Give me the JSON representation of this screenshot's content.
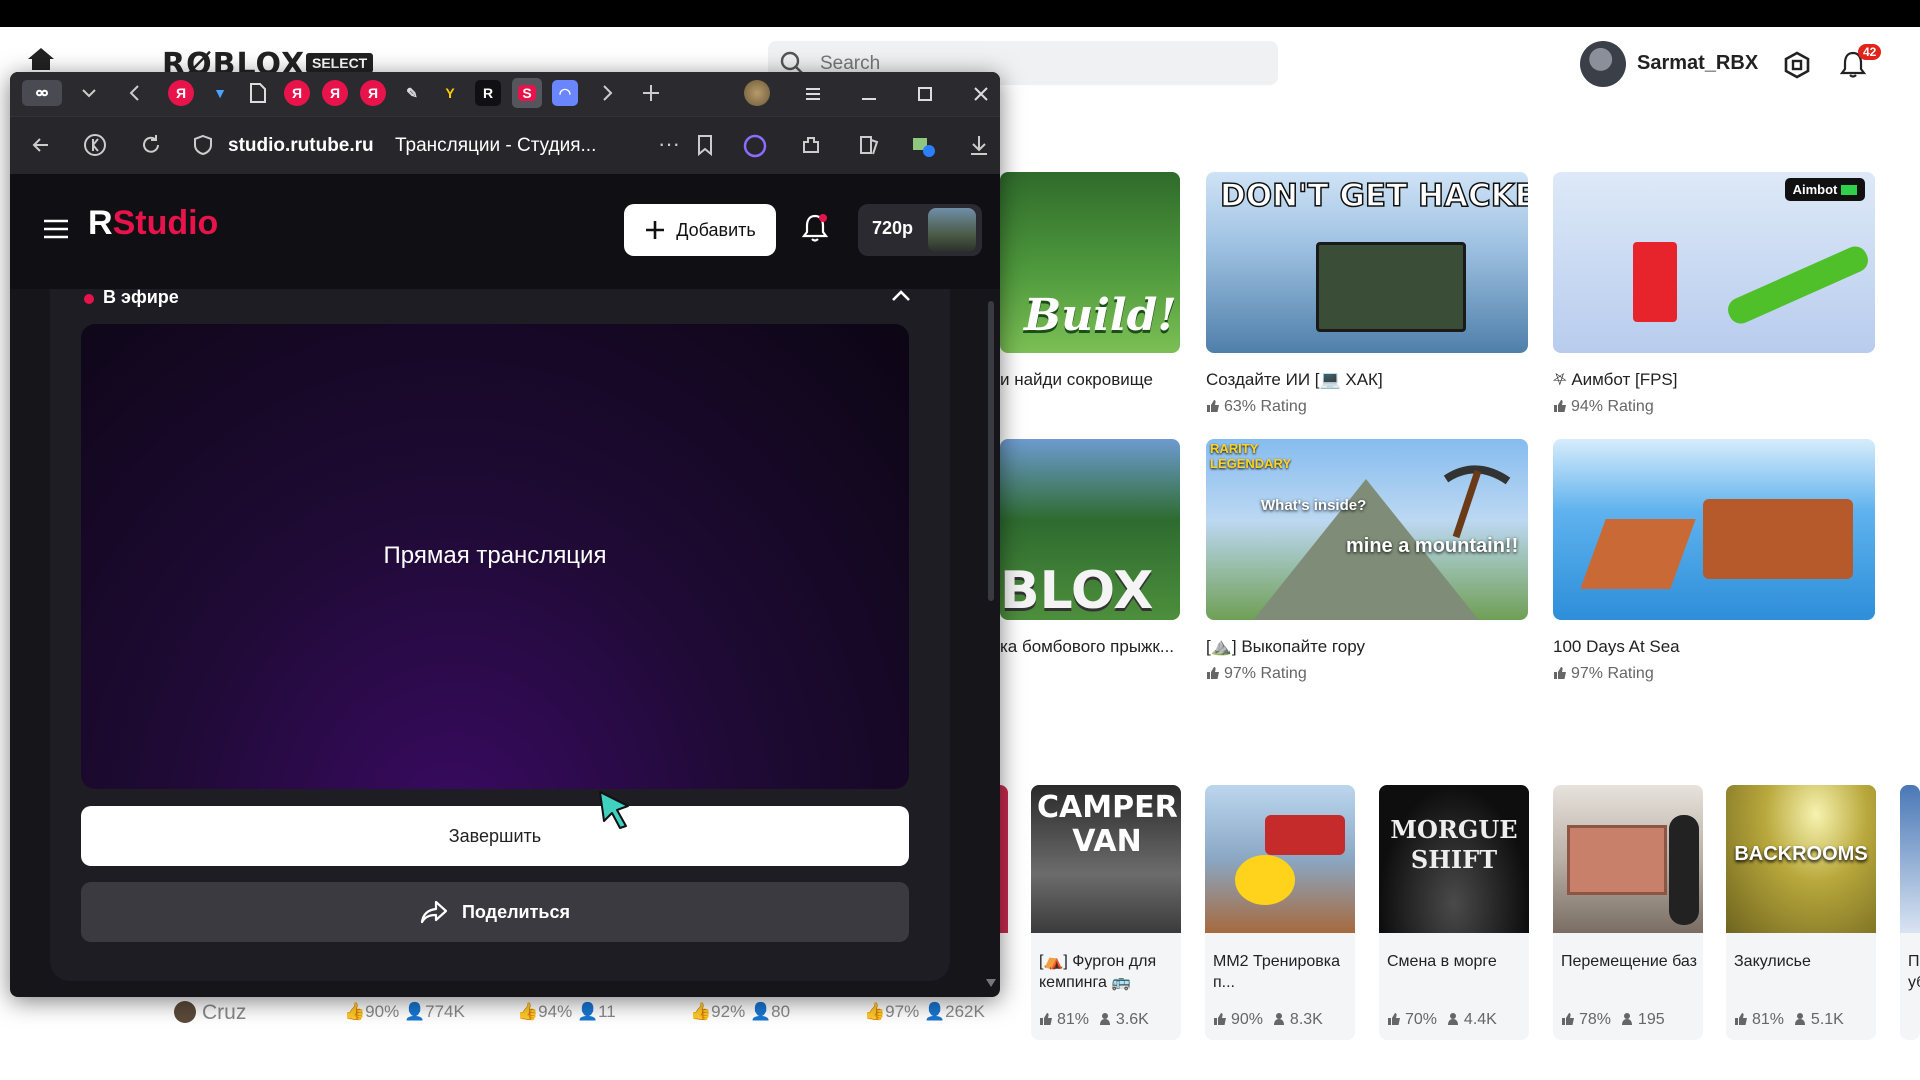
{
  "roblox": {
    "logo": "RØBLOX",
    "select_badge": "SELECT",
    "search_placeholder": "Search",
    "username": "Sarmat_RBX",
    "notification_count": "42",
    "grid_cards": [
      {
        "title": "и найди сокровище",
        "rating": "",
        "thumb_text": "Build!"
      },
      {
        "title": "Создайте ИИ [💻 ХАК]",
        "rating": "63% Rating",
        "thumb_text": "DON'T GET HACKED"
      },
      {
        "title": "⛧ Аимбот [FPS]",
        "rating": "94% Rating",
        "thumb_text": "Aimbot"
      },
      {
        "title": "ка бомбового прыжк...",
        "rating": "",
        "thumb_text": "BLOX"
      },
      {
        "title": "[⛰️] Выкопайте гору",
        "rating": "97% Rating",
        "thumb_text_top": "RARITY LEGENDARY",
        "thumb_text_mid": "What's inside?",
        "thumb_text_bottom": "mine a mountain!!"
      },
      {
        "title": "100 Days At Sea",
        "rating": "97% Rating"
      }
    ],
    "small_cards": [
      {
        "title": "[⛺] Фургон для кемпинга 🚌",
        "rating": "81%",
        "players": "3.6K",
        "thumb_text": "CAMPER VAN"
      },
      {
        "title": "MM2 Тренировка п...",
        "rating": "90%",
        "players": "8.3K"
      },
      {
        "title": "Смена в морге",
        "rating": "70%",
        "players": "4.4K",
        "thumb_text": "MORGUE SHIFT"
      },
      {
        "title": "Перемещение баз",
        "rating": "78%",
        "players": "195"
      },
      {
        "title": "Закулисье",
        "rating": "81%",
        "players": "5.1K",
        "thumb_text": "BACKROOMS"
      }
    ],
    "edge_card_title": "П уб",
    "bottom_row": {
      "creator": "Cruz",
      "stats": [
        {
          "rating": "90%",
          "players": "774K"
        },
        {
          "rating": "94%",
          "players": "11"
        },
        {
          "rating": "92%",
          "players": "80"
        },
        {
          "rating": "97%",
          "players": "262K"
        }
      ]
    }
  },
  "browser": {
    "url": "studio.rutube.ru",
    "page_title": "Трансляции - Студия...",
    "more": "···"
  },
  "studio": {
    "logo_r": "R",
    "logo_studio": "Studio",
    "add_button": "Добавить",
    "quality": "720p",
    "live_section": "В эфире",
    "stream_label": "Прямая трансляция",
    "finish_button": "Завершить",
    "share_button": "Поделиться"
  },
  "colors": {
    "accent_red": "#e8134b",
    "window_bg": "#15151a",
    "panel_bg": "#1d1d23"
  }
}
